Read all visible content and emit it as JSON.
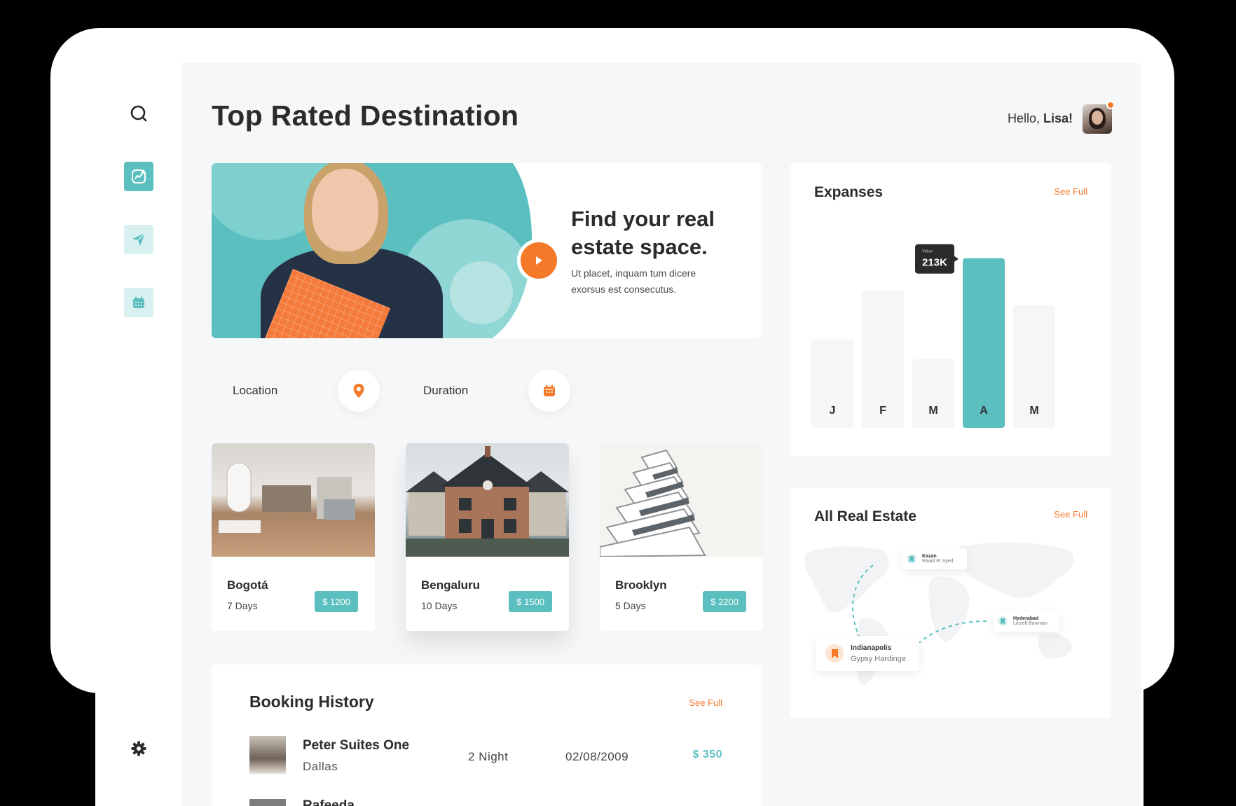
{
  "header": {
    "title": "Top Rated Destination",
    "greeting_prefix": "Hello, ",
    "greeting_name": "Lisa!"
  },
  "sidebar": {
    "items": [
      {
        "name": "search",
        "icon": "search-icon"
      },
      {
        "name": "analytics",
        "icon": "chart-icon",
        "active": true
      },
      {
        "name": "send",
        "icon": "paper-plane-icon"
      },
      {
        "name": "calendar",
        "icon": "calendar-icon"
      },
      {
        "name": "settings",
        "icon": "gear-icon"
      }
    ]
  },
  "hero": {
    "title": "Find your real estate space.",
    "subtitle": "Ut placet, inquam tum dicere exorsus est consecutus."
  },
  "filters": {
    "location_label": "Location",
    "duration_label": "Duration"
  },
  "properties": [
    {
      "name": "Bogotá",
      "days": "7 Days",
      "price": "$ 1200"
    },
    {
      "name": "Bengaluru",
      "days": "10 Days",
      "price": "$ 1500"
    },
    {
      "name": "Brooklyn",
      "days": "5 Days",
      "price": "$ 2200"
    }
  ],
  "booking": {
    "title": "Booking History",
    "see_full": "See Full",
    "rows": [
      {
        "name": "Peter Suites One",
        "city": "Dallas",
        "nights": "2 Night",
        "date": "02/08/2009",
        "price": "$ 350"
      },
      {
        "name": "Rafeeda"
      }
    ]
  },
  "expenses": {
    "title": "Expanses",
    "see_full": "See Full"
  },
  "chart_data": {
    "type": "bar",
    "title": "Expanses",
    "categories": [
      "J",
      "F",
      "M",
      "A",
      "M"
    ],
    "values": [
      115,
      178,
      89,
      220,
      159
    ],
    "highlight_index": 3,
    "tooltip": {
      "label": "Value",
      "value": "213K"
    },
    "colors": {
      "bar": "#f5f6f8",
      "highlight": "#5bbfbf"
    }
  },
  "estate": {
    "title": "All Real Estate",
    "see_full": "See Full",
    "pins": [
      {
        "city": "Kazan",
        "person": "Raaid El Syed"
      },
      {
        "city": "Hyderabad",
        "person": "Linzell Bowman"
      },
      {
        "city": "Indianapolis",
        "person": "Gypsy Hardinge"
      }
    ]
  },
  "colors": {
    "accent": "#5bbfbf",
    "orange": "#f47a2a",
    "text": "#2b2b2b"
  }
}
